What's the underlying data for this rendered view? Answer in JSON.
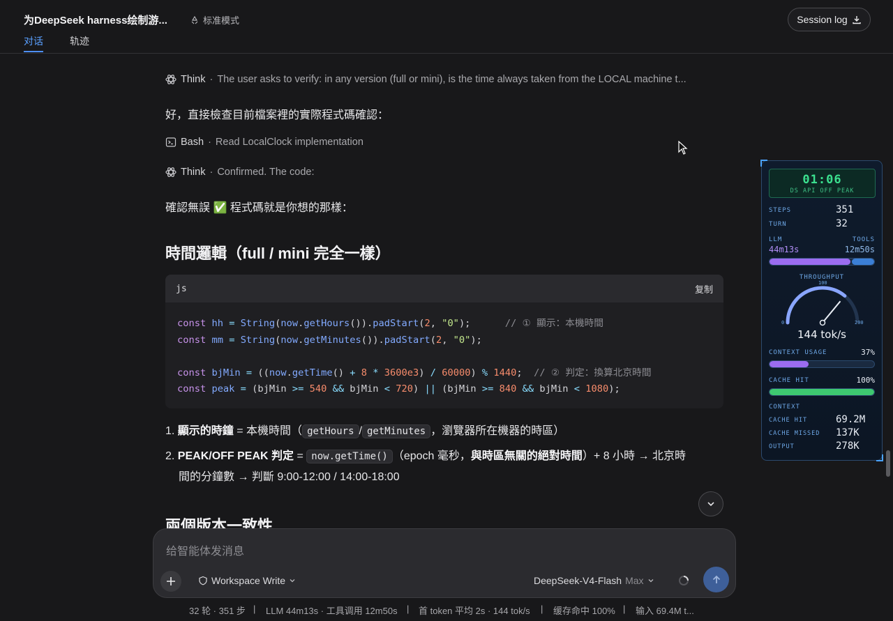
{
  "header": {
    "title": "为DeepSeek harness绘制游...",
    "mode_label": "标准模式",
    "session_button": "Session log",
    "tabs": [
      {
        "label": "对话"
      },
      {
        "label": "轨迹"
      }
    ]
  },
  "content": {
    "steps": [
      {
        "kind": "Think",
        "sep": "·",
        "text": "The user asks to verify: in any version (full or mini), is the time always taken from the LOCAL machine t..."
      },
      {
        "kind": "Bash",
        "sep": "·",
        "text": "Read LocalClock implementation"
      },
      {
        "kind": "Think",
        "sep": "·",
        "text": "Confirmed. The code:"
      }
    ],
    "para1": "好，直接檢查目前檔案裡的實際程式碼確認：",
    "para2_a": "確認無誤",
    "para2_emoji": "✅",
    "para2_b": "程式碼就是你想的那樣：",
    "heading1": "時間邏輯（full / mini 完全一樣）",
    "code": {
      "lang": "js",
      "copy_label": "复制"
    },
    "list": [
      {
        "num": "1.",
        "bold": "顯示的時鐘",
        "eq": " = 本機時間（",
        "c1": "getHours",
        "slash": "/",
        "c2": "getMinutes",
        "tail": "，瀏覽器所在機器的時區）"
      },
      {
        "num": "2.",
        "bold": "PEAK/OFF PEAK 判定",
        "eq": " = ",
        "c1": "now.getTime()",
        "mid": "（epoch 毫秒，",
        "bold2": "與時區無關的絕對時間",
        "tail": "）+ 8 小時 → 北京時",
        "line2": "間的分鐘數 → 判斷 9:00-12:00 / 14:00-18:00"
      }
    ],
    "heading2": "兩個版本一致性"
  },
  "composer": {
    "placeholder": "给智能体发消息",
    "workspace_label": "Workspace Write",
    "model_name": "DeepSeek-V4-Flash",
    "model_tier": "Max"
  },
  "footer": {
    "turns": "32 轮 · 351 步",
    "llm": "LLM 44m13s · 工具调用 12m50s",
    "token": "首 token 平均 2s · 144 tok/s",
    "cache": "缓存命中 100%",
    "input": "输入 69.4M t...",
    "sep": "|"
  },
  "hud": {
    "clock_time": "01:06",
    "clock_label": "DS API OFF PEAK",
    "steps_label": "STEPS",
    "steps_value": "351",
    "turn_label": "TURN",
    "turn_value": "32",
    "llm_label": "LLM",
    "llm_value": "44m13s",
    "tools_label": "TOOLS",
    "tools_value": "12m50s",
    "llm_fraction": 0.775,
    "throughput_label": "THROUGHPUT",
    "gauge_min": "0",
    "gauge_mid": "100",
    "gauge_max": "200",
    "throughput_value": "144 tok/s",
    "throughput_number": 144,
    "context_label": "CONTEXT USAGE",
    "context_value": "37%",
    "context_fraction": 0.37,
    "cache_label": "CACHE HIT",
    "cache_value": "100%",
    "cache_fraction": 1.0,
    "context_section": "CONTEXT",
    "cache_hit_label": "CACHE HIT",
    "cache_hit_value": "69.2M",
    "cache_missed_label": "CACHE MISSED",
    "cache_missed_value": "137K",
    "output_label": "OUTPUT",
    "output_value": "278K"
  },
  "colors": {
    "accent": "#4d8ff7",
    "llm_bar": "#9b6cf0",
    "tools_bar": "#3b7fd6",
    "cache_bar": "#3ec870",
    "clock": "#3be08f"
  }
}
